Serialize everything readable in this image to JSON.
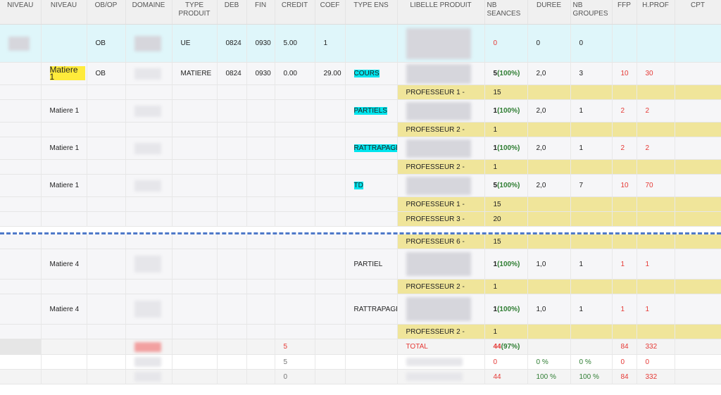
{
  "headers": [
    "NIVEAU",
    "NIVEAU",
    "OB/OP",
    "DOMAINE",
    "TYPE PRODUIT",
    "DEB",
    "FIN",
    "CREDIT",
    "COEF",
    "TYPE ENS",
    "LIBELLE PRODUIT",
    "NB SEANCES",
    "DUREE",
    "NB GROUPES",
    "FFP",
    "H.PROF",
    "CPT"
  ],
  "ue_row": {
    "obop": "OB",
    "type": "UE",
    "deb": "0824",
    "fin": "0930",
    "credit": "5.00",
    "coef": "1",
    "nb_seances": "0",
    "duree": "0",
    "nb_groupes": "0"
  },
  "mat1": {
    "niveau": "Matiere 1",
    "obop": "OB",
    "type": "MATIERE",
    "deb": "0824",
    "fin": "0930",
    "credit": "0.00",
    "coef": "29.00",
    "type_ens": "COURS",
    "nb_seances": "5",
    "pct": "(100%)",
    "duree": "2,0",
    "nb_groupes": "3",
    "ffp": "10",
    "hprof": "30"
  },
  "prof1": {
    "label": "PROFESSEUR 1 -",
    "value": "15"
  },
  "mat2": {
    "niveau": "Matiere 1",
    "type_ens": "PARTIELS",
    "nb_seances": "1",
    "pct": "(100%)",
    "duree": "2,0",
    "nb_groupes": "1",
    "ffp": "2",
    "hprof": "2"
  },
  "prof2": {
    "label": "PROFESSEUR 2 -",
    "value": "1"
  },
  "mat3": {
    "niveau": "Matiere 1",
    "type_ens": "RATTRAPAGE",
    "nb_seances": "1",
    "pct": "(100%)",
    "duree": "2,0",
    "nb_groupes": "1",
    "ffp": "2",
    "hprof": "2"
  },
  "prof3": {
    "label": "PROFESSEUR 2 -",
    "value": "1"
  },
  "mat4": {
    "niveau": "Matiere 1",
    "type_ens": "TD",
    "nb_seances": "5",
    "pct": "(100%)",
    "duree": "2,0",
    "nb_groupes": "7",
    "ffp": "10",
    "hprof": "70"
  },
  "prof4": {
    "label": "PROFESSEUR 1 -",
    "value": "15"
  },
  "prof5": {
    "label": "PROFESSEUR 3 -",
    "value": "20"
  },
  "prof6": {
    "label": "PROFESSEUR 6 -",
    "value": "15"
  },
  "mat5": {
    "niveau": "Matiere 4",
    "type_ens": "PARTIEL",
    "nb_seances": "1",
    "pct": "(100%)",
    "duree": "1,0",
    "nb_groupes": "1",
    "ffp": "1",
    "hprof": "1"
  },
  "prof7": {
    "label": "PROFESSEUR 2 -",
    "value": "1"
  },
  "mat6": {
    "niveau": "Matiere 4",
    "type_ens": "RATTRAPAGE",
    "nb_seances": "1",
    "pct": "(100%)",
    "duree": "1,0",
    "nb_groupes": "1",
    "ffp": "1",
    "hprof": "1"
  },
  "prof8": {
    "label": "PROFESSEUR 2 -",
    "value": "1"
  },
  "total": {
    "credit": "5",
    "label": "TOTAL",
    "nb_seances": "44",
    "pct": "(97%)",
    "ffp": "84",
    "hprof": "332"
  },
  "total2": {
    "credit": "5",
    "nb_seances": "0",
    "duree": "0 %",
    "nb_groupes": "0 %",
    "ffp": "0",
    "hprof": "0"
  },
  "total3": {
    "credit": "0",
    "nb_seances": "44",
    "duree": "100 %",
    "nb_groupes": "100 %",
    "ffp": "84",
    "hprof": "332"
  },
  "colors": {
    "header_bg": "#f0f0f0",
    "ue_row_bg": "#dff6fa",
    "prof_row_bg": "#f0e59a",
    "cyan_highlight": "#00e5ee",
    "yellow_highlight": "#ffeb3b",
    "red": "#e53935",
    "green": "#2e7d32",
    "dash": "#4f79c9"
  }
}
